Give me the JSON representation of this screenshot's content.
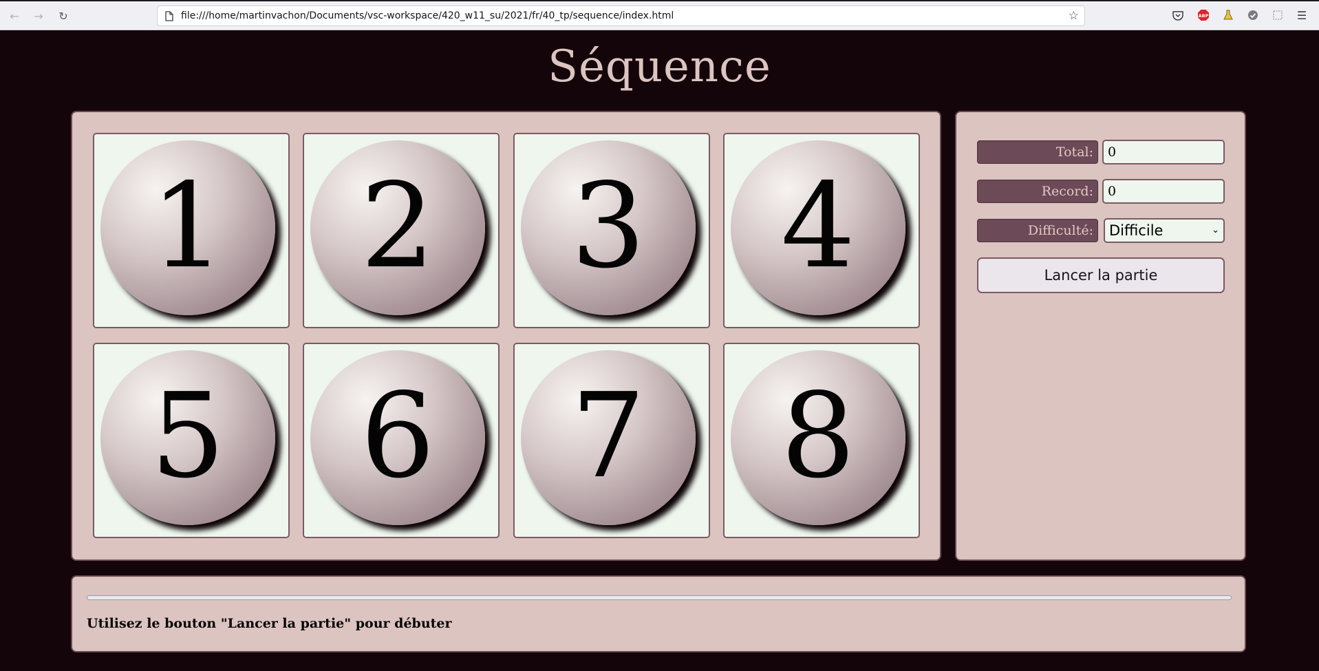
{
  "browser": {
    "url": "file:///home/martinvachon/Documents/vsc-workspace/420_w11_su/2021/fr/40_tp/sequence/index.html",
    "adblock_label": "ABP"
  },
  "page": {
    "title": "Séquence"
  },
  "board": {
    "balls": [
      "1",
      "2",
      "3",
      "4",
      "5",
      "6",
      "7",
      "8"
    ]
  },
  "controls": {
    "total_label": "Total:",
    "total_value": "0",
    "record_label": "Record:",
    "record_value": "0",
    "difficulty_label": "Difficulté:",
    "difficulty_selected": "Difficile",
    "start_button": "Lancer la partie"
  },
  "status": {
    "progress": 0,
    "message": "Utilisez le bouton \"Lancer la partie\" pour débuter"
  },
  "colors": {
    "page_background": "#130509",
    "panel": "#dcc4c0",
    "label_background": "#6c4a57",
    "cell_background": "#eef6ee"
  }
}
